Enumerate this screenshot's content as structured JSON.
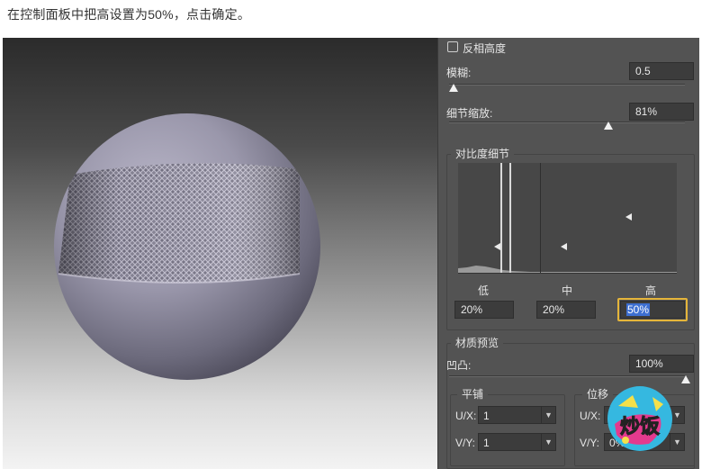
{
  "caption": "在控制面板中把高设置为50%，点击确定。",
  "panel": {
    "invert_height_label": "反相高度",
    "blur": {
      "label": "模糊:",
      "value": "0.5",
      "level": 0.0
    },
    "detail_scale": {
      "label": "细节缩放:",
      "value": "81%",
      "level": 0.81
    },
    "contrast_detail": {
      "title": "对比度细节",
      "low_label": "低",
      "mid_label": "中",
      "high_label": "高",
      "low_value": "20%",
      "mid_value": "20%",
      "high_value": "50%"
    },
    "material_preview": {
      "title": "材质预览",
      "bump": {
        "label": "凹凸:",
        "value": "100%",
        "level": 1.0
      },
      "tiling": {
        "title": "平铺",
        "ux_label": "U/X:",
        "ux_value": "1",
        "vy_label": "V/Y:",
        "vy_value": "1"
      },
      "offset": {
        "title": "位移",
        "ux_label": "U/X:",
        "vy_label": "V/Y:",
        "vy_value": "0%"
      }
    }
  },
  "colors": {
    "panel_bg": "#535353",
    "highlight": "#e5b53a",
    "selection": "#3d6fd1"
  },
  "watermark_text": "炒饭"
}
